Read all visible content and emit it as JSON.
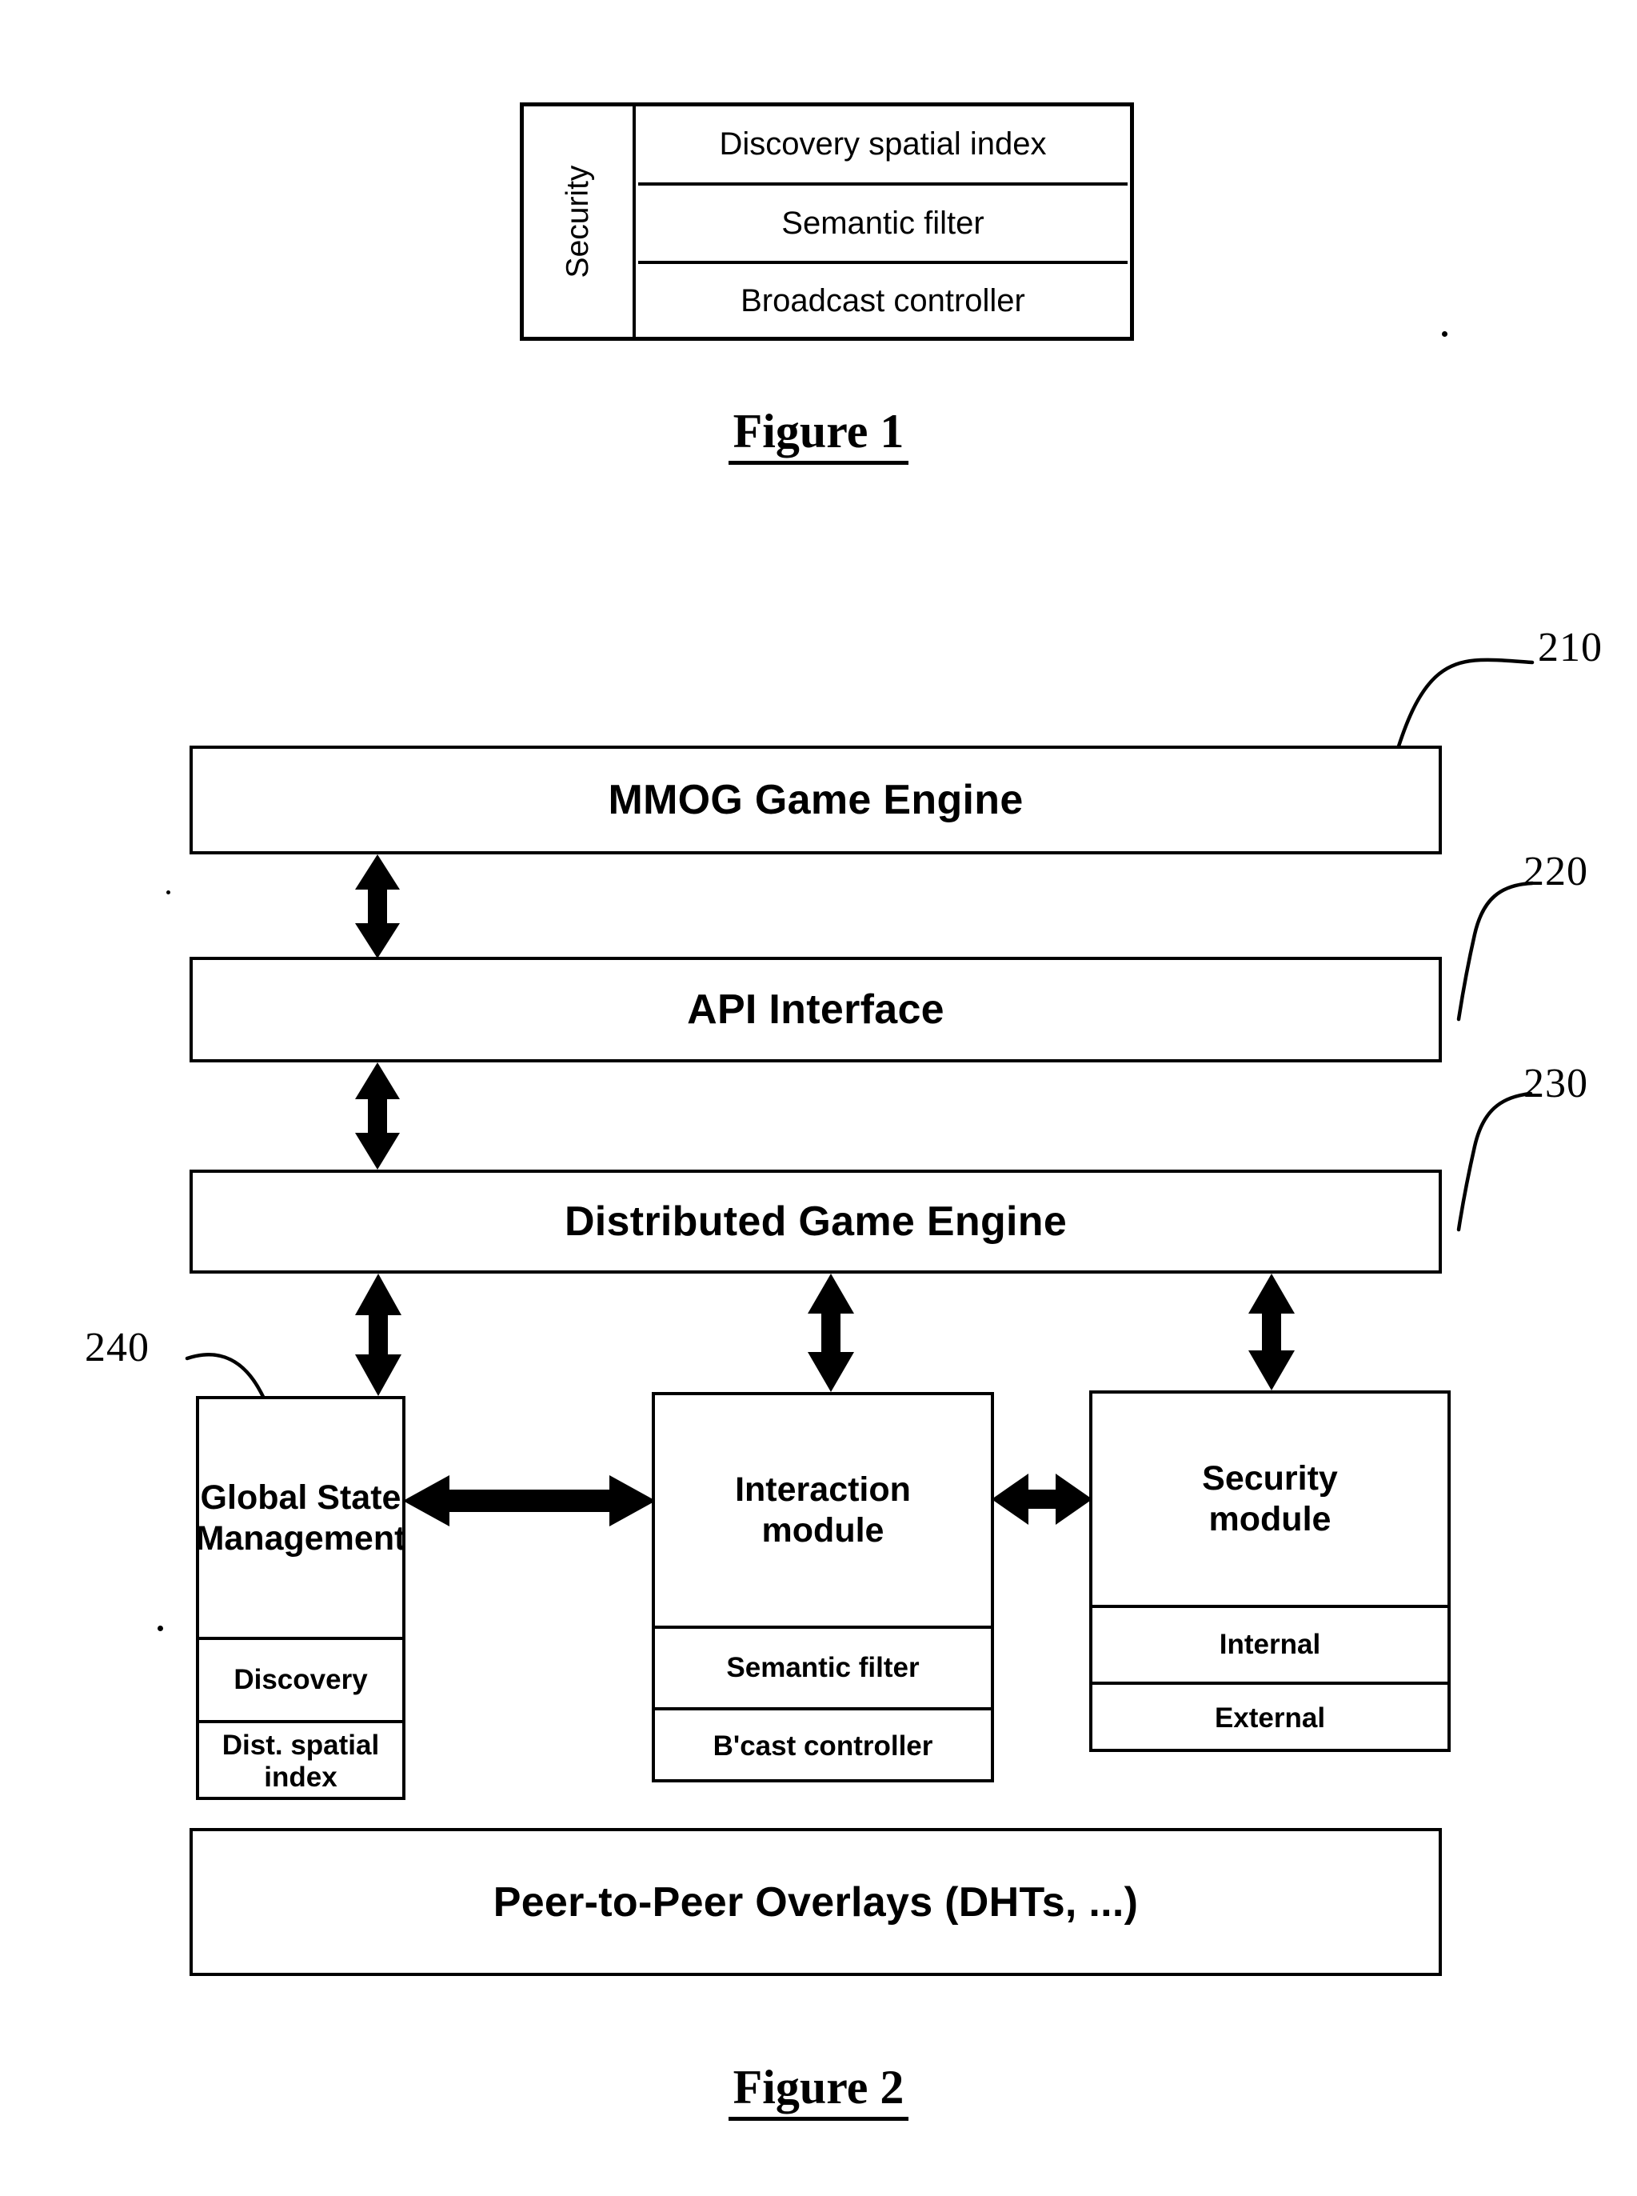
{
  "figure1": {
    "side_label": "Security",
    "rows": [
      "Discovery spatial index",
      "Semantic filter",
      "Broadcast controller"
    ],
    "caption": "Figure 1"
  },
  "figure2": {
    "caption": "Figure 2",
    "layers": [
      {
        "label": "MMOG Game Engine",
        "ref": "210"
      },
      {
        "label": "API Interface",
        "ref": "220"
      },
      {
        "label": "Distributed Game Engine",
        "ref": "230"
      }
    ],
    "modules": [
      {
        "title": "Global State\nManagement",
        "title_line1": "Global State",
        "title_line2": "Management",
        "sub": [
          "Discovery",
          "Dist. spatial index"
        ],
        "ref": "240"
      },
      {
        "title_line1": "Interaction",
        "title_line2": "module",
        "sub": [
          "Semantic filter",
          "B'cast controller"
        ]
      },
      {
        "title_line1": "Security",
        "title_line2": "module",
        "sub": [
          "Internal",
          "External"
        ]
      }
    ],
    "bottom_layer": "Peer-to-Peer Overlays (DHTs, ...)"
  },
  "colors": {
    "ink": "#000000",
    "paper": "#ffffff"
  }
}
